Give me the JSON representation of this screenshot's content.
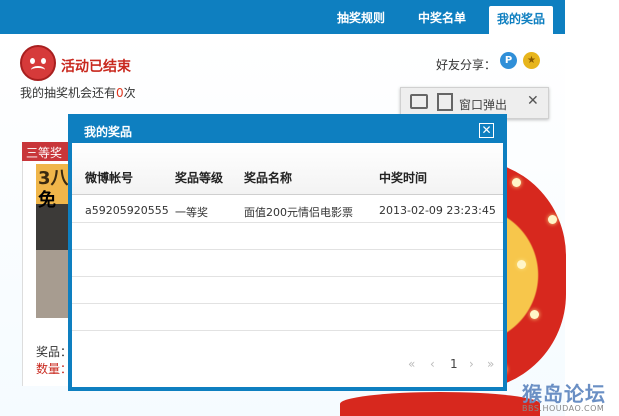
{
  "tabs": [
    {
      "label": "抽奖规则"
    },
    {
      "label": "中奖名单"
    },
    {
      "label": "我的奖品",
      "active": true
    }
  ],
  "status": {
    "title": "活动已结束",
    "chances_prefix": "我的抽奖机会还有",
    "chances_count": "0",
    "chances_suffix": "次"
  },
  "share": {
    "label": "好友分享："
  },
  "popout": {
    "label": "窗口弹出",
    "close": "✕"
  },
  "background_card": {
    "tag": "三等奖",
    "image_text1": "3八",
    "image_text2": "免",
    "prize_label": "奖品：",
    "qty_label": "数量："
  },
  "modal": {
    "title": "我的奖品",
    "close": "✕",
    "columns": [
      "微博帐号",
      "奖品等级",
      "奖品名称",
      "中奖时间"
    ],
    "rows": [
      {
        "account": "a59205920555",
        "level": "一等奖",
        "name": "面值200元情侣电影票",
        "time": "2013-02-09 23:23:45"
      }
    ],
    "pager": {
      "first": "«",
      "prev": "‹",
      "page": "1",
      "next": "›",
      "last": "»"
    }
  },
  "watermark": {
    "big": "猴岛论坛",
    "small": "BBS.HOUDAO.COM"
  },
  "colors": {
    "brand": "#0e7fc0",
    "alert": "#c8281e"
  }
}
